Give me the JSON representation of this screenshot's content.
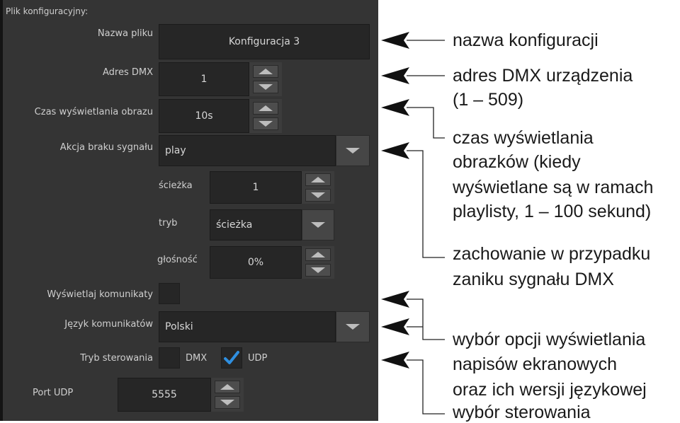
{
  "panel": {
    "title": "Plik konfiguracyjny:",
    "file_name": {
      "label": "Nazwa pliku",
      "value": "Konfiguracja 3"
    },
    "dmx_address": {
      "label": "Adres DMX",
      "value": "1"
    },
    "image_time": {
      "label": "Czas wyświetlania obrazu",
      "value": "10s"
    },
    "no_signal_action": {
      "label": "Akcja braku sygnału",
      "value": "play"
    },
    "track": {
      "label": "ścieżka",
      "value": "1"
    },
    "mode": {
      "label": "tryb",
      "value": "ścieżka"
    },
    "volume": {
      "label": "głośność",
      "value": "0%"
    },
    "show_messages": {
      "label": "Wyświetlaj komunikaty",
      "checked": false
    },
    "message_language": {
      "label": "Język komunikatów",
      "value": "Polski"
    },
    "control_mode": {
      "label": "Tryb sterowania",
      "options": [
        {
          "label": "DMX",
          "checked": false
        },
        {
          "label": "UDP",
          "checked": true
        }
      ]
    },
    "udp_port": {
      "label": "Port UDP",
      "value": "5555"
    },
    "accent_color": "#2f8fe0"
  },
  "annotations": {
    "config_name": "nazwa konfiguracji",
    "dmx_line1": "adres DMX urządzenia",
    "dmx_line2": "(1 – 509)",
    "time_line1": "czas wyświetlania",
    "time_line2": "obrazków (kiedy",
    "time_line3": "wyświetlane są w ramach",
    "time_line4": "playlisty, 1 – 100 sekund)",
    "signal_line1": "zachowanie w przypadku",
    "signal_line2": "zaniku sygnału DMX",
    "msg_line1": "wybór opcji wyświetlania",
    "msg_line2": "napisów ekranowych",
    "msg_line3": "oraz ich wersji językowej",
    "control_line1": "wybór sterowania"
  }
}
